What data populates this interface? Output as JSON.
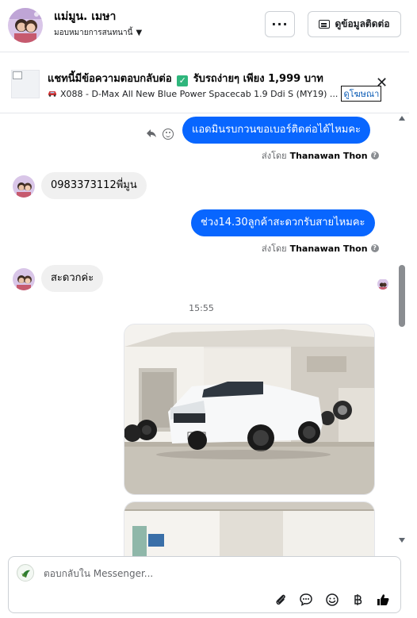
{
  "header": {
    "contact_name": "แม่มูน. เมษา",
    "assign_label": "มอบหมายการสนทนานี้",
    "more_label": "···",
    "contact_info_label": "ดูข้อมูลติดต่อ"
  },
  "ad": {
    "title_part1": "แชทนี้มีข้อความตอบกลับต่อ",
    "title_check": "✓",
    "title_part2": "รับรถง่ายๆ เพียง 1,999 บาท",
    "subtitle": "X088 - D-Max All New Blue Power Spacecab 1.9 Ddi S (MY19) ...",
    "link_label": "ดูโฆษณา",
    "close_label": "✕"
  },
  "messages": [
    {
      "direction": "out",
      "text": "แอดมินรบกวนขอเบอร์ติดต่อได้ไหมคะ",
      "sent_prefix": "ส่งโดย",
      "sender": "Thanawan Thon"
    },
    {
      "direction": "in",
      "text": "0983373112พี่มูน"
    },
    {
      "direction": "out",
      "text": "ช่วง14.30ลูกค้าสะดวกรับสายไหมคะ",
      "sent_prefix": "ส่งโดย",
      "sender": "Thanawan Thon"
    },
    {
      "direction": "in",
      "text": "สะดวกค่ะ"
    }
  ],
  "timestamp": "15:55",
  "composer": {
    "placeholder": "ตอบกลับใน Messenger..."
  },
  "icons": {
    "reply": "reply-icon",
    "react": "emoji-icon",
    "attach": "paperclip-icon",
    "saved_replies": "chat-bubble-icon",
    "emoji": "smiley-icon",
    "payment": "baht-icon",
    "like": "thumbs-up-icon"
  },
  "colors": {
    "outgoing_bubble": "#0866ff",
    "incoming_bubble": "#f0f0f0",
    "link": "#0a5bb5",
    "like_button": "#050505"
  }
}
